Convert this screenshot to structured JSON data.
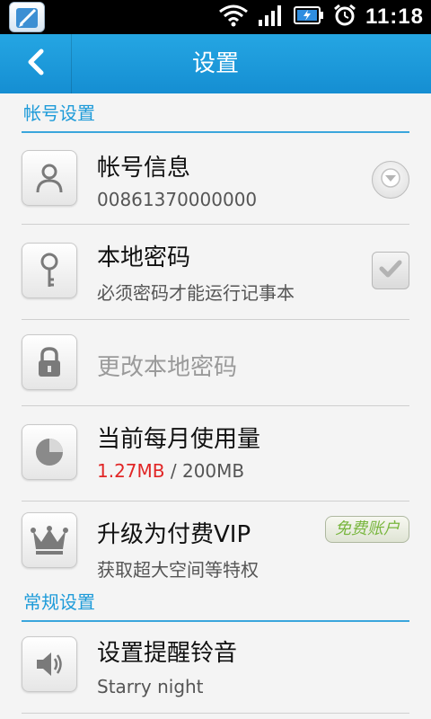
{
  "status_bar": {
    "time": "11:18"
  },
  "header": {
    "title": "设置"
  },
  "sections": {
    "account": {
      "title": "帐号设置"
    },
    "general": {
      "title": "常规设置"
    }
  },
  "rows": {
    "account_info": {
      "title": "帐号信息",
      "value": "00861370000000"
    },
    "local_password": {
      "title": "本地密码",
      "subtitle": "必须密码才能运行记事本"
    },
    "change_password": {
      "title": "更改本地密码"
    },
    "usage": {
      "title": "当前每月使用量",
      "used": "1.27MB",
      "separator": " / ",
      "limit": "200MB"
    },
    "vip": {
      "title": "升级为付费VIP",
      "subtitle": "获取超大空间等特权",
      "badge": "免费账户"
    },
    "ringtone": {
      "title": "设置提醒铃音",
      "value": "Starry night"
    }
  },
  "colors": {
    "accent": "#1e9bd9",
    "titlebar": "#1a9ad9",
    "usage_used": "#e12626",
    "badge_text": "#79b63f"
  }
}
